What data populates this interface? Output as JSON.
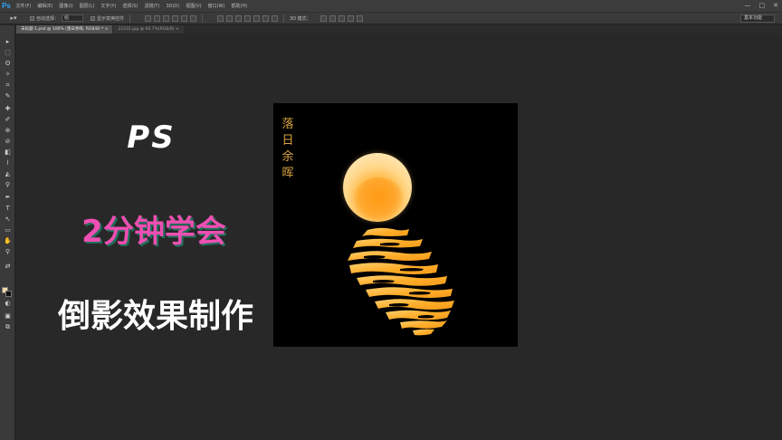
{
  "app": {
    "logo": "Ps",
    "menu": [
      "文件(F)",
      "编辑(E)",
      "图像(I)",
      "图层(L)",
      "文字(Y)",
      "选择(S)",
      "滤镜(T)",
      "3D(D)",
      "视图(V)",
      "窗口(W)",
      "帮助(H)"
    ],
    "window_controls": [
      "—",
      "□",
      "✕"
    ]
  },
  "options_bar": {
    "auto_select_label": "自动选择：",
    "auto_select_value": "组",
    "show_transform_label": "显示变换控件",
    "mode_3d_label": "3D 模式：",
    "workspace": "基本功能"
  },
  "tabs": [
    {
      "label": "未标题-1.psd @ 100% (落日余晖, RGB/8) *",
      "close": "×"
    },
    {
      "label": "22222.jpg @ 66.7%(RGB/8)",
      "close": "×"
    }
  ],
  "tools": [
    "▸",
    "⬚",
    "ʘ",
    "✧",
    "⌗",
    "✎",
    "✚",
    "✐",
    "⊛",
    "⊘",
    "◧",
    "⌇",
    "◭",
    "⚲",
    "✒",
    "T",
    "↖",
    "▭",
    "✋",
    "⚲",
    "⇄",
    "◐",
    "▣",
    "⧉"
  ],
  "promo": {
    "title_ps": "PS",
    "title_2min": "2分钟学会",
    "title_effect": "倒影效果制作"
  },
  "artwork": {
    "poem_chars": [
      "落",
      "日",
      "余",
      "晖"
    ]
  },
  "colors": {
    "foreground": "#f3d9a8",
    "background": "#111111",
    "accent_pink": "#ee4fb2",
    "poem_gold": "#d9a441"
  }
}
